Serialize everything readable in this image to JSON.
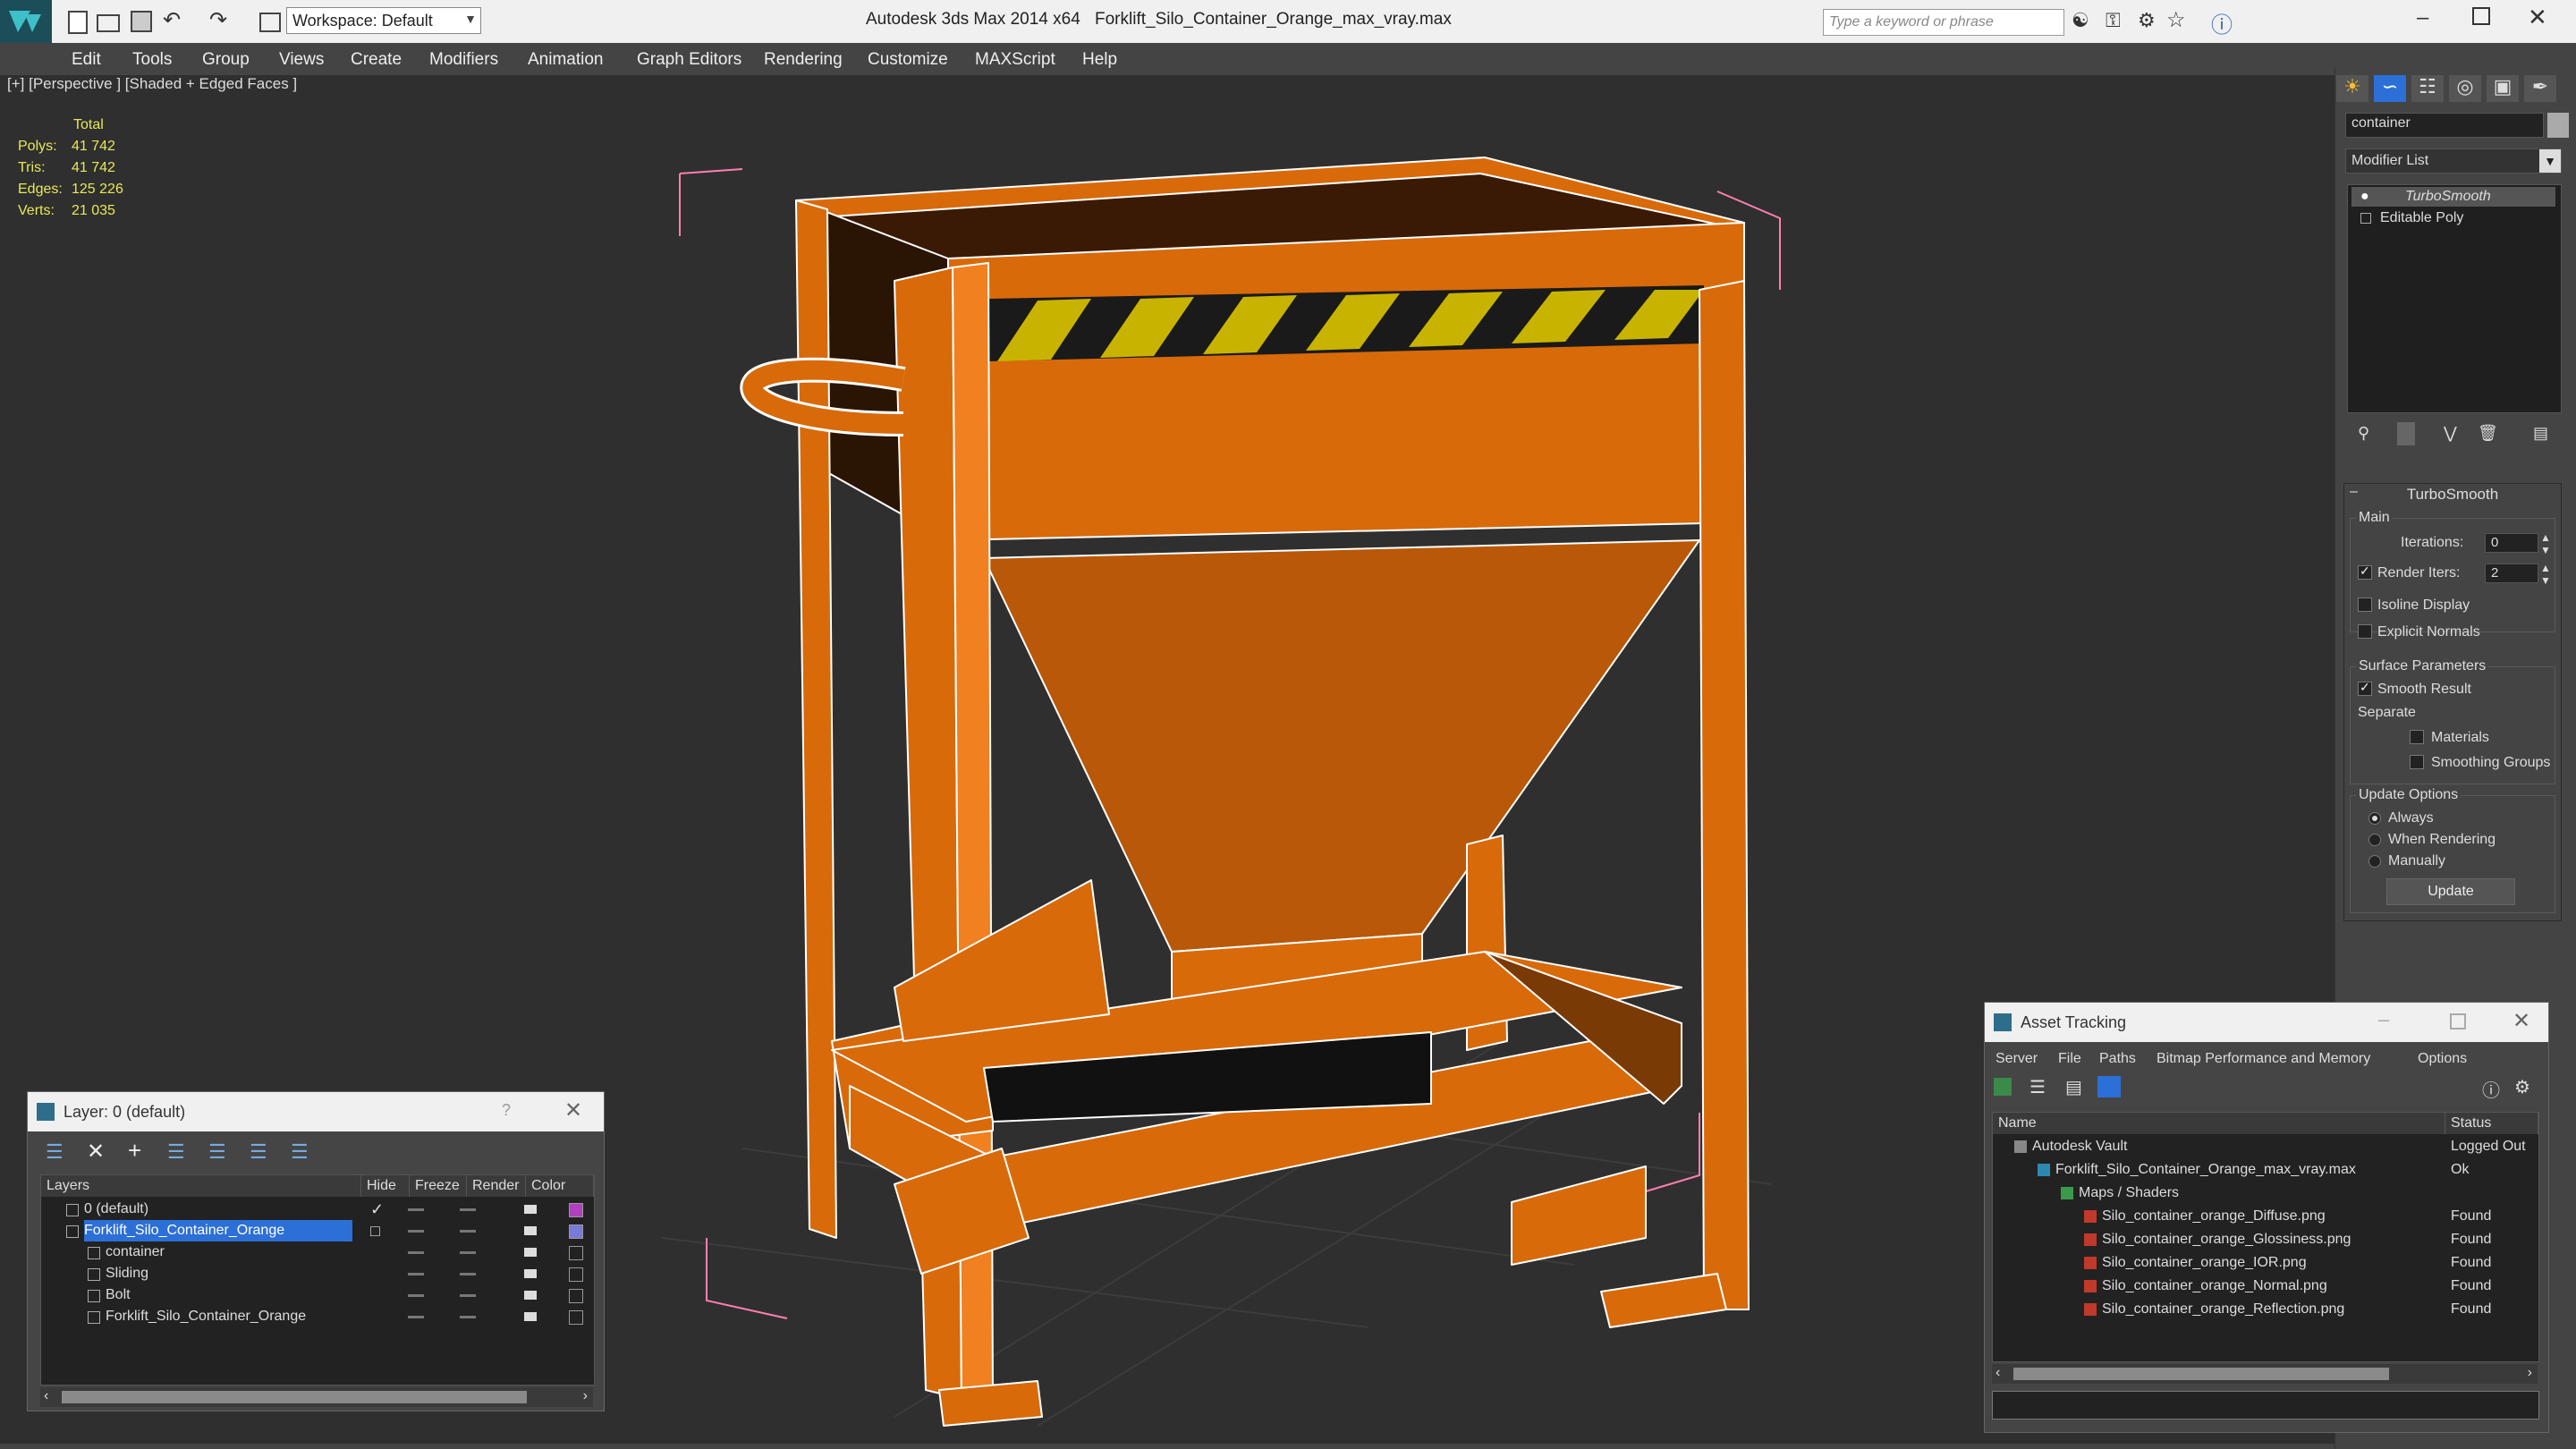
{
  "app": {
    "title": "Autodesk 3ds Max 2014 x64",
    "file": "Forklift_Silo_Container_Orange_max_vray.max",
    "workspace": "Workspace: Default",
    "search_placeholder": "Type a keyword or phrase"
  },
  "menu": [
    "Edit",
    "Tools",
    "Group",
    "Views",
    "Create",
    "Modifiers",
    "Animation",
    "Graph Editors",
    "Rendering",
    "Customize",
    "MAXScript",
    "Help"
  ],
  "viewport": {
    "label": "[+] [Perspective ] [Shaded + Edged Faces ]",
    "stats": {
      "header": "Total",
      "rows": [
        {
          "label": "Polys:",
          "value": "41 742"
        },
        {
          "label": "Tris:",
          "value": "41 742"
        },
        {
          "label": "Edges:",
          "value": "125 226"
        },
        {
          "label": "Verts:",
          "value": "21 035"
        }
      ]
    }
  },
  "command_panel": {
    "object_name": "container",
    "modifier_list": "Modifier List",
    "stack": [
      "TurboSmooth",
      "Editable Poly"
    ],
    "rollout_title": "TurboSmooth",
    "main_group": "Main",
    "iterations_label": "Iterations:",
    "iterations_value": "0",
    "render_iters_label": "Render Iters:",
    "render_iters_value": "2",
    "isoline": "Isoline Display",
    "explicit_normals": "Explicit Normals",
    "surface_group": "Surface Parameters",
    "smooth_result": "Smooth Result",
    "separate": "Separate",
    "materials": "Materials",
    "smoothing_groups": "Smoothing Groups",
    "update_group": "Update Options",
    "always": "Always",
    "when_rendering": "When Rendering",
    "manually": "Manually",
    "update_button": "Update"
  },
  "layer_window": {
    "title": "Layer: 0 (default)",
    "help": "?",
    "columns": [
      "Layers",
      "Hide",
      "Freeze",
      "Render",
      "Color"
    ],
    "rows": [
      {
        "name": "0 (default)",
        "indent": 1,
        "color": "#b040c0",
        "selected": false,
        "check": true
      },
      {
        "name": "Forklift_Silo_Container_Orange",
        "indent": 1,
        "color": "#7a7ad8",
        "selected": true,
        "check": false
      },
      {
        "name": "container",
        "indent": 2,
        "color": "#222222",
        "selected": false,
        "check": false
      },
      {
        "name": "Sliding",
        "indent": 2,
        "color": "#222222",
        "selected": false,
        "check": false
      },
      {
        "name": "Bolt",
        "indent": 2,
        "color": "#222222",
        "selected": false,
        "check": false
      },
      {
        "name": "Forklift_Silo_Container_Orange",
        "indent": 2,
        "color": "#222222",
        "selected": false,
        "check": false
      }
    ]
  },
  "asset_window": {
    "title": "Asset Tracking",
    "menu": [
      "Server",
      "File",
      "Paths",
      "Bitmap Performance and Memory",
      "Options"
    ],
    "columns": [
      "Name",
      "Status"
    ],
    "rows": [
      {
        "name": "Autodesk Vault",
        "status": "Logged Out",
        "indent": 1
      },
      {
        "name": "Forklift_Silo_Container_Orange_max_vray.max",
        "status": "Ok",
        "indent": 2
      },
      {
        "name": "Maps / Shaders",
        "status": "",
        "indent": 3
      },
      {
        "name": "Silo_container_orange_Diffuse.png",
        "status": "Found",
        "indent": 4
      },
      {
        "name": "Silo_container_orange_Glossiness.png",
        "status": "Found",
        "indent": 4
      },
      {
        "name": "Silo_container_orange_IOR.png",
        "status": "Found",
        "indent": 4
      },
      {
        "name": "Silo_container_orange_Normal.png",
        "status": "Found",
        "indent": 4
      },
      {
        "name": "Silo_container_orange_Reflection.png",
        "status": "Found",
        "indent": 4
      }
    ]
  },
  "colors": {
    "model": "#d86a0a",
    "wire": "#ffffff",
    "selection": "#ff7fb0",
    "stats": "#e8e85a"
  }
}
